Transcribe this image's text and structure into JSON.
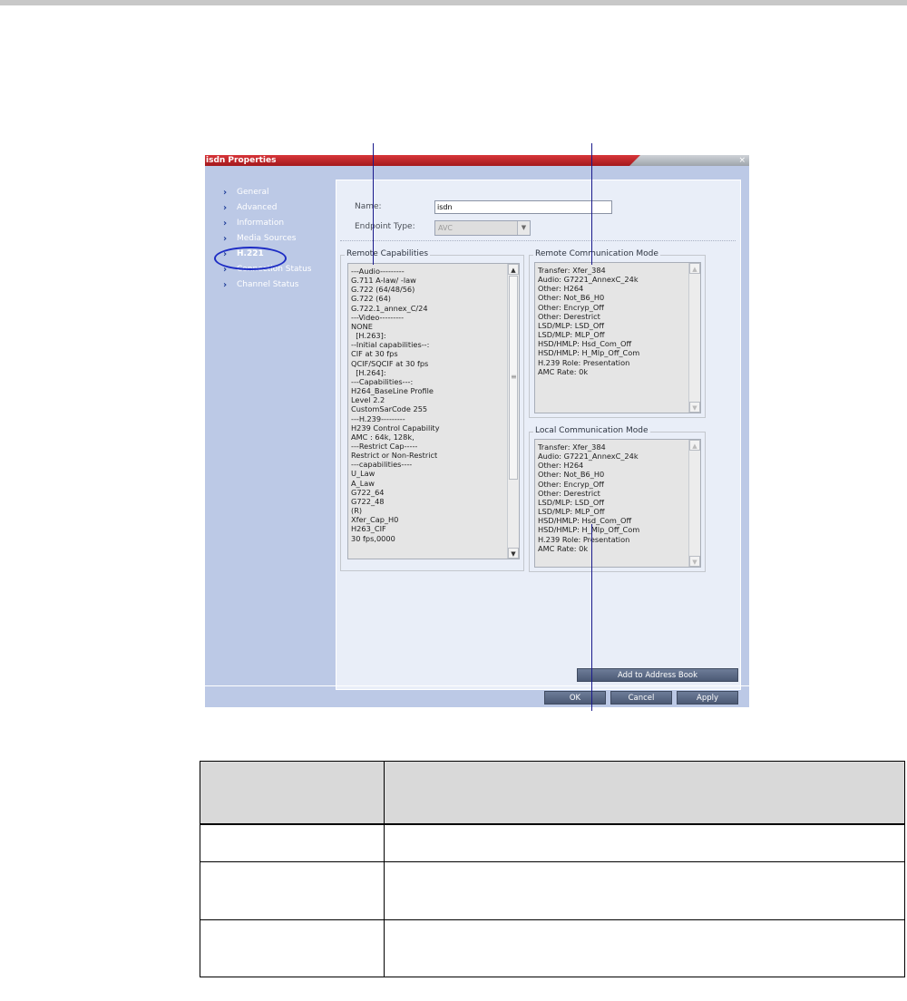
{
  "dialog": {
    "title": "isdn Properties",
    "close_glyph": "×"
  },
  "nav": {
    "items": [
      {
        "label": "General",
        "active": false
      },
      {
        "label": "Advanced",
        "active": false
      },
      {
        "label": "Information",
        "active": false
      },
      {
        "label": "Media Sources",
        "active": false
      },
      {
        "label": "H.221",
        "active": true
      },
      {
        "label": "Connection Status",
        "active": false
      },
      {
        "label": "Channel Status",
        "active": false
      }
    ]
  },
  "form": {
    "name_label": "Name:",
    "name_value": "isdn",
    "endpoint_type_label": "Endpoint Type:",
    "endpoint_type_value": "AVC"
  },
  "remote_capabilities": {
    "title": "Remote Capabilities",
    "lines": [
      "---Audio---------",
      "G.711 A-law/ -law",
      "G.722 (64/48/56)",
      "G.722 (64)",
      "G.722.1_annex_C/24",
      "---Video---------",
      "NONE",
      "  [H.263]:",
      "--Initial capabilities--:",
      "CIF at 30 fps",
      "QCIF/SQCIF at 30 fps",
      "  [H.264]:",
      "---Capabilities---:",
      "H264_BaseLine Profile",
      "Level 2.2",
      "CustomSarCode 255",
      "---H.239---------",
      "H239 Control Capability",
      "AMC : 64k, 128k,",
      "---Restrict Cap-----",
      "Restrict or Non-Restrict",
      "---capabilities----",
      "U_Law",
      "A_Law",
      "G722_64",
      "G722_48",
      "(R)",
      "Xfer_Cap_H0",
      "H263_CIF",
      "30 fps,0000"
    ]
  },
  "remote_comm_mode": {
    "title": "Remote Communication Mode",
    "lines": [
      "Transfer: Xfer_384",
      "Audio: G7221_AnnexC_24k",
      "Other: H264",
      "Other: Not_B6_H0",
      "Other: Encryp_Off",
      "Other: Derestrict",
      "LSD/MLP: LSD_Off",
      "LSD/MLP: MLP_Off",
      "HSD/HMLP: Hsd_Com_Off",
      "HSD/HMLP: H_Mlp_Off_Com",
      "H.239 Role: Presentation",
      "AMC Rate: 0k"
    ]
  },
  "local_comm_mode": {
    "title": "Local Communication Mode",
    "lines": [
      "Transfer: Xfer_384",
      "Audio: G7221_AnnexC_24k",
      "Other: H264",
      "Other: Not_B6_H0",
      "Other: Encryp_Off",
      "Other: Derestrict",
      "LSD/MLP: LSD_Off",
      "LSD/MLP: MLP_Off",
      "HSD/HMLP: Hsd_Com_Off",
      "HSD/HMLP: H_Mlp_Off_Com",
      "H.239 Role: Presentation",
      "AMC Rate: 0k"
    ]
  },
  "buttons": {
    "add_to_address_book": "Add to Address Book",
    "ok": "OK",
    "cancel": "Cancel",
    "apply": "Apply"
  },
  "glyphs": {
    "chevron": "›",
    "arrow_up": "▲",
    "arrow_down": "▼",
    "grip": "≡"
  }
}
